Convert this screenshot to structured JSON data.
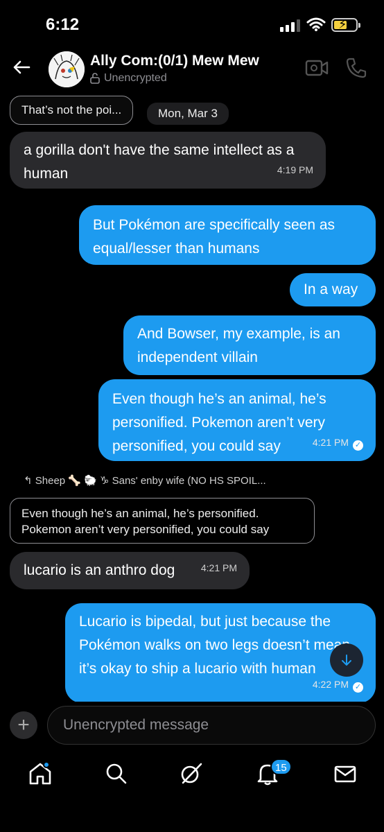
{
  "status_bar": {
    "time": "6:12"
  },
  "header": {
    "title": "Ally Com:(0/1) Mew Mew",
    "subtitle": "Unencrypted"
  },
  "messages": {
    "reply_chip": "That’s not the poi...",
    "date": "Mon, Mar 3",
    "m1": {
      "text": "a gorilla don't have the same intellect as a human",
      "time": "4:19 PM"
    },
    "m2": {
      "text": "But Pokémon are specifically seen as equal/lesser than humans"
    },
    "m3": {
      "text": "In a way"
    },
    "m4": {
      "text": "And Bowser, my example, is an independent villain"
    },
    "m5": {
      "text": "Even though he’s an animal, he’s personified. Pokemon aren’t very personified, you could say",
      "time": "4:21 PM"
    },
    "reply_ref": "Sheep 🦴 🐑 ♑ Sans' enby wife (NO HS SPOIL...",
    "quote": "Even though he’s an animal, he’s personified. Pokemon aren’t very personified, you could say",
    "m6": {
      "text": "lucario is an anthro dog",
      "time": "4:21 PM"
    },
    "m7": {
      "text": "Lucario is bipedal, but just because the Pokémon walks on two legs doesn’t mean it’s okay to ship a lucario with human",
      "time": "4:22 PM"
    }
  },
  "composer": {
    "placeholder": "Unencrypted message"
  },
  "nav": {
    "notifications_badge": "15",
    "icons": [
      "home-icon",
      "search-icon",
      "grok-icon",
      "bell-icon",
      "mail-icon"
    ]
  },
  "colors": {
    "accent": "#1d9bf0",
    "incoming_bubble": "#2a2a2d",
    "background": "#000000"
  }
}
